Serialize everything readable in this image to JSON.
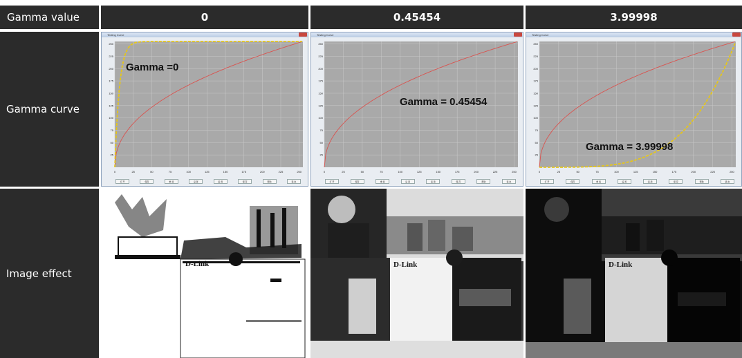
{
  "header": {
    "row_label": "Gamma value",
    "values": [
      "0",
      "0.45454",
      "3.99998"
    ]
  },
  "rows": {
    "curve_label": "Gamma curve",
    "effect_label": "Image effect"
  },
  "panels": [
    {
      "window_title": "Testing Curve",
      "annotation": "Gamma =0",
      "gamma": 0
    },
    {
      "window_title": "Testing Curve",
      "annotation": "Gamma = 0.45454",
      "gamma": 0.45454
    },
    {
      "window_title": "Testing Curve",
      "annotation": "Gamma = 3.99998",
      "gamma": 3.99998
    }
  ],
  "chart_data": [
    {
      "type": "line",
      "xlim": [
        0,
        255
      ],
      "ylim": [
        0,
        255
      ],
      "x_ticks": [
        "0",
        "25",
        "50",
        "75",
        "100",
        "125",
        "150",
        "175",
        "200",
        "225",
        "250"
      ],
      "y_ticks": [
        "25",
        "50",
        "75",
        "100",
        "125",
        "150",
        "175",
        "200",
        "225",
        "250"
      ],
      "series": [
        {
          "gamma": 0.45454,
          "color": "#d9534f"
        },
        {
          "gamma": 0,
          "color": "#e6c619",
          "dashed": true
        }
      ]
    },
    {
      "type": "line",
      "xlim": [
        0,
        255
      ],
      "ylim": [
        0,
        255
      ],
      "x_ticks": [
        "0",
        "25",
        "50",
        "75",
        "100",
        "125",
        "150",
        "175",
        "200",
        "225",
        "250"
      ],
      "y_ticks": [
        "25",
        "50",
        "75",
        "100",
        "125",
        "150",
        "175",
        "200",
        "225",
        "250"
      ],
      "series": [
        {
          "gamma": 0.45454,
          "color": "#d9534f"
        }
      ]
    },
    {
      "type": "line",
      "xlim": [
        0,
        255
      ],
      "ylim": [
        0,
        255
      ],
      "x_ticks": [
        "0",
        "25",
        "50",
        "75",
        "100",
        "125",
        "150",
        "175",
        "200",
        "225",
        "250"
      ],
      "y_ticks": [
        "25",
        "50",
        "75",
        "100",
        "125",
        "150",
        "175",
        "200",
        "225",
        "250"
      ],
      "series": [
        {
          "gamma": 0.45454,
          "color": "#d9534f"
        },
        {
          "gamma": 3.99998,
          "color": "#e6c619",
          "dashed": true
        }
      ]
    }
  ],
  "window_buttons": [
    "打 开",
    "保存",
    "重 载",
    "设 置",
    "运 用",
    "保 存",
    "帮助",
    "退 出"
  ],
  "photos": [
    {
      "brand": "D-Link",
      "style": "washed"
    },
    {
      "brand": "D-Link",
      "style": "normal"
    },
    {
      "brand": "D-Link",
      "style": "dark"
    }
  ],
  "colors": {
    "header_bg": "#2b2b2b",
    "grid_bg": "#a9a9a9",
    "grid_line": "#c9c9c9",
    "curve_red": "#d9534f",
    "curve_yellow": "#e6c619"
  }
}
